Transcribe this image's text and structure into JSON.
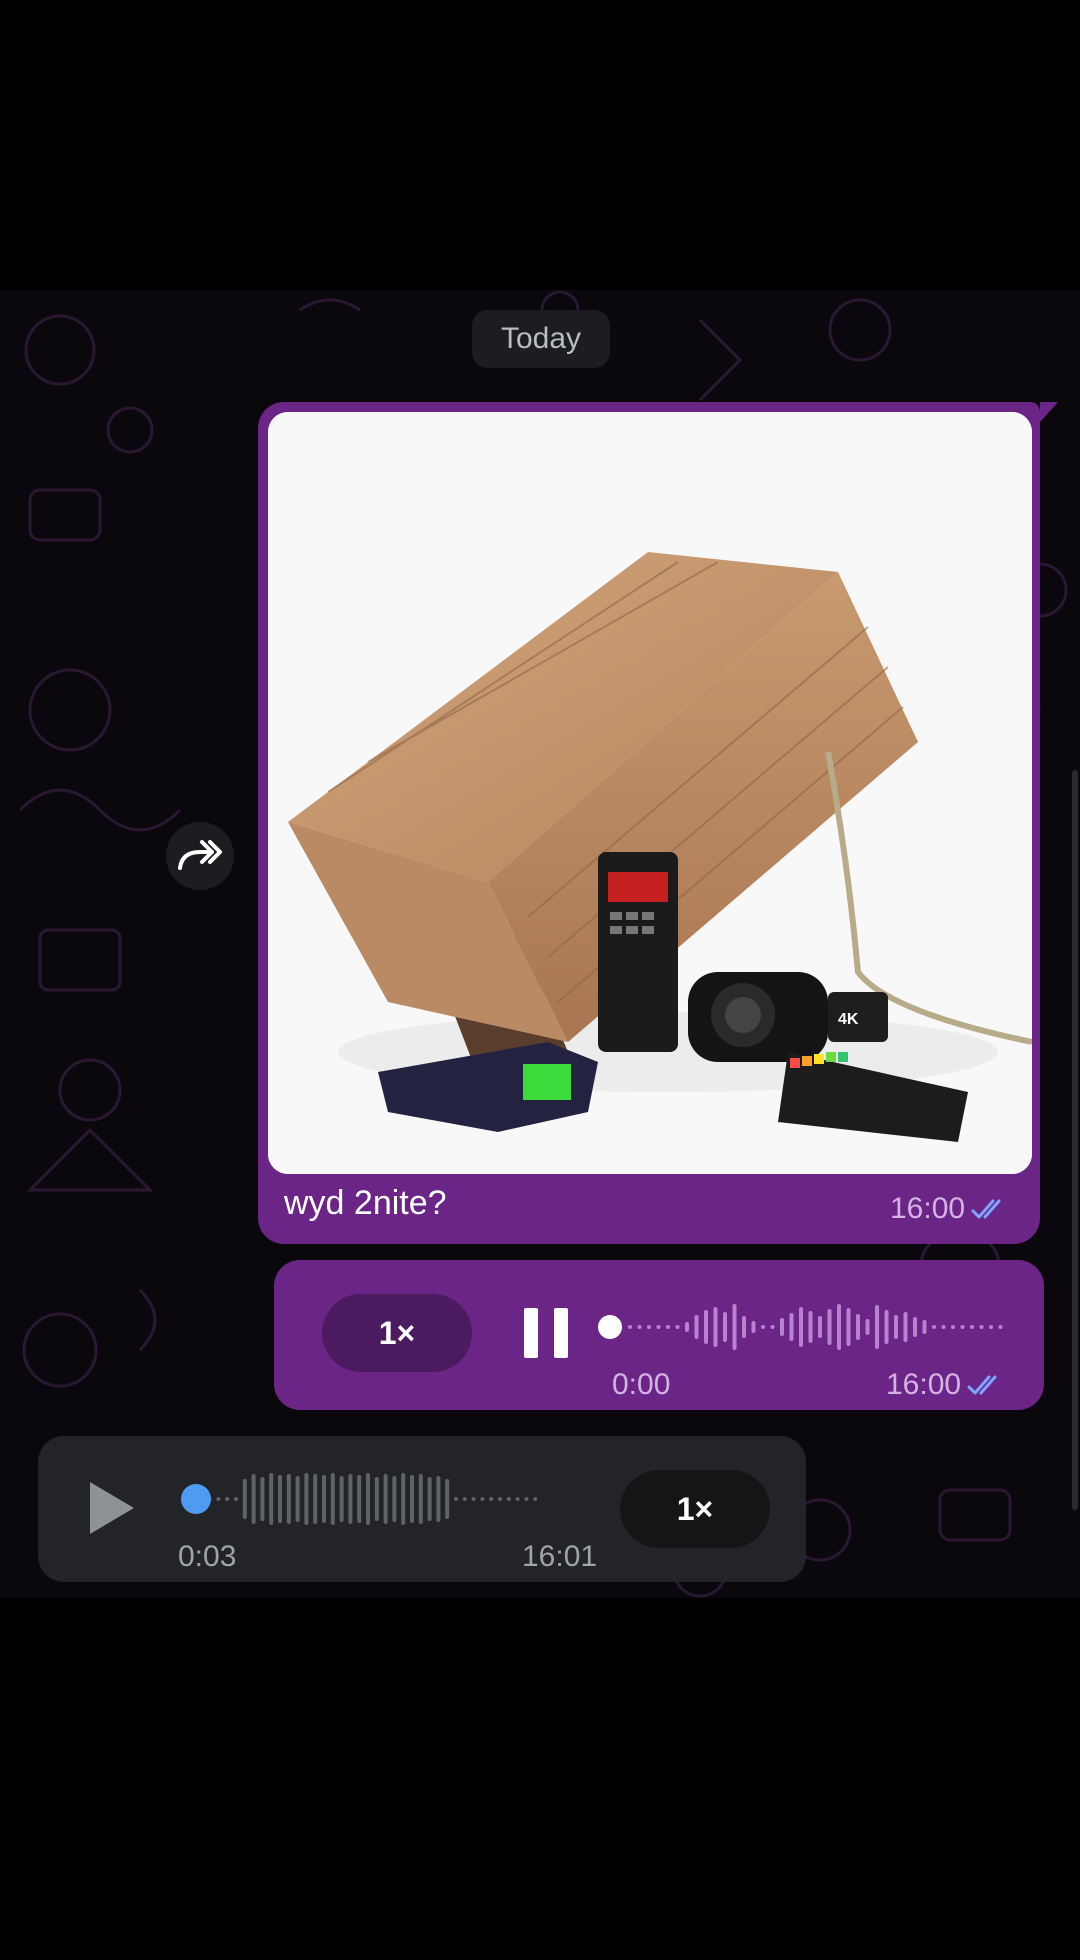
{
  "date_separator": "Today",
  "messages": {
    "photo_message": {
      "image_description_icon": "box-trap-with-ghost-hunting-gadgets-image",
      "caption": "wyd 2nite?",
      "time": "16:00",
      "status_icon": "double-check-icon"
    },
    "voice_outgoing": {
      "speed": "1×",
      "state_icon": "pause-icon",
      "elapsed": "0:00",
      "time": "16:00",
      "status_icon": "double-check-icon",
      "progress": 0.0
    },
    "voice_incoming": {
      "state_icon": "play-icon",
      "elapsed": "0:03",
      "time": "16:01",
      "speed": "1×",
      "progress": 0.0
    }
  },
  "colors": {
    "outgoing_bubble": "#6b2587",
    "incoming_bubble": "#222427",
    "read_check": "#7ea6ff",
    "progress_dot_incoming": "#4f9bf4"
  }
}
